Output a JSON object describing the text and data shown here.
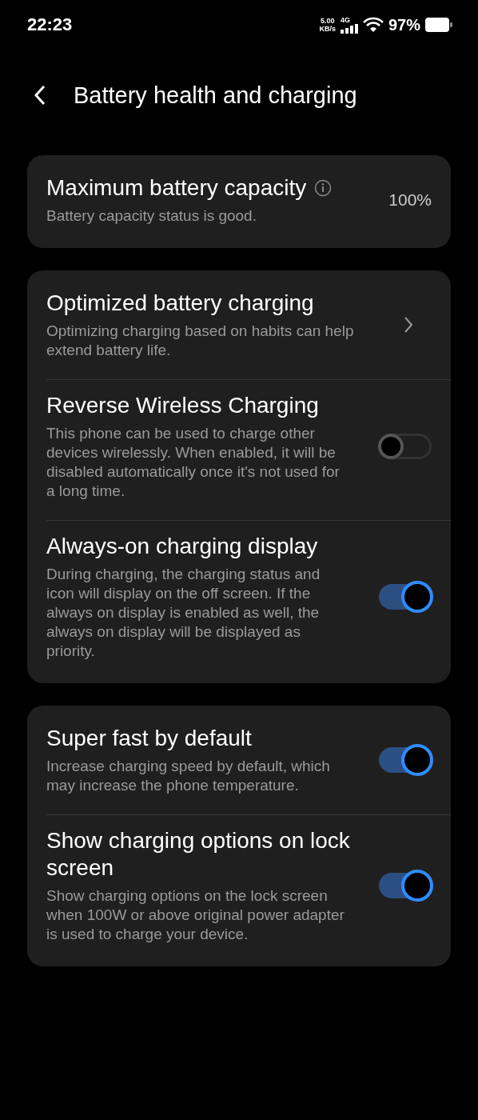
{
  "status_bar": {
    "time": "22:23",
    "net_speed": "5.00",
    "net_unit": "KB/s",
    "network": "4G",
    "battery": "97%"
  },
  "header": {
    "title": "Battery health and charging"
  },
  "groups": [
    {
      "rows": [
        {
          "kind": "value",
          "title": "Maximum battery capacity",
          "info": true,
          "subtitle": "Battery capacity status is good.",
          "value": "100%"
        }
      ]
    },
    {
      "rows": [
        {
          "kind": "link",
          "title": "Optimized battery charging",
          "subtitle": "Optimizing charging based on habits can help extend battery life."
        },
        {
          "kind": "toggle",
          "title": "Reverse Wireless Charging",
          "subtitle": "This phone can be used to charge other devices wirelessly. When enabled, it will be disabled automatically once it's not used for a long time.",
          "on": false
        },
        {
          "kind": "toggle",
          "title": "Always-on charging display",
          "subtitle": "During charging, the charging status and icon will display on the off screen. If the always on display is enabled as well, the always on display will be displayed as priority.",
          "on": true
        }
      ]
    },
    {
      "rows": [
        {
          "kind": "toggle",
          "title": "Super fast by default",
          "subtitle": "Increase charging speed by default, which may increase the phone temperature.",
          "on": true
        },
        {
          "kind": "toggle",
          "title": "Show charging options on lock screen",
          "subtitle": "Show charging options on the lock screen when 100W or above original power adapter is used to charge your device.",
          "on": true
        }
      ]
    }
  ]
}
